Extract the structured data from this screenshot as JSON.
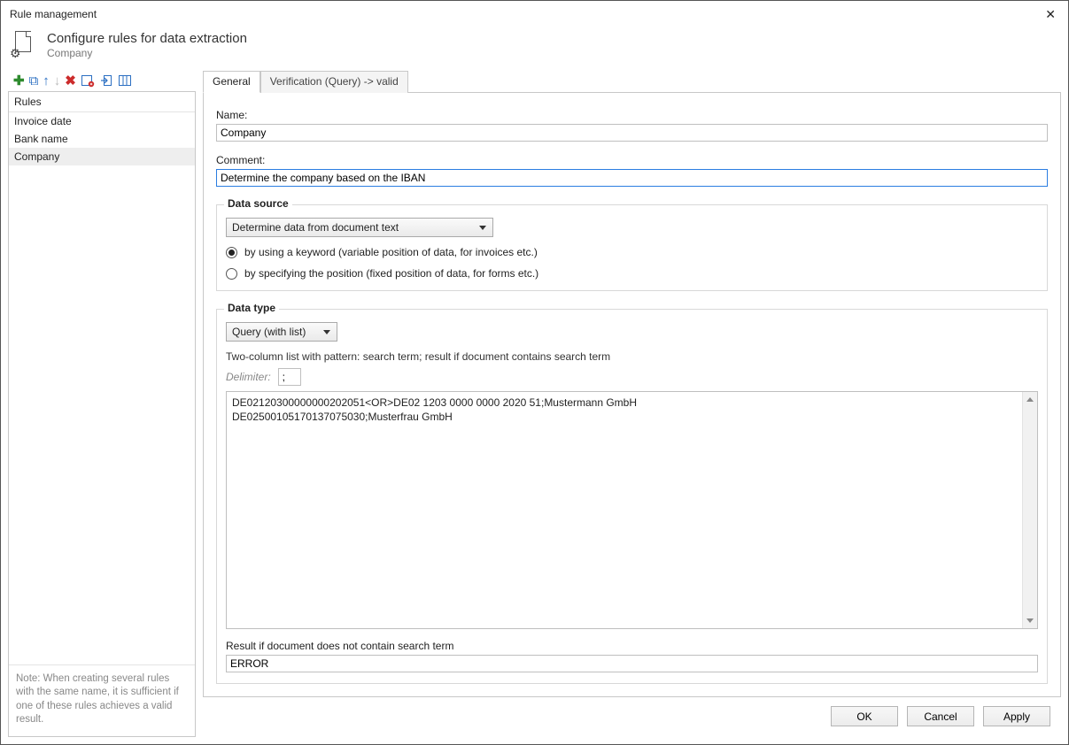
{
  "window": {
    "title": "Rule management"
  },
  "header": {
    "title": "Configure rules for data extraction",
    "subtitle": "Company"
  },
  "sidebar": {
    "header": "Rules",
    "items": [
      "Invoice date",
      "Bank name",
      "Company"
    ],
    "selected_index": 2,
    "note": "Note: When creating several rules with the same name, it is sufficient if one of these rules achieves a valid result."
  },
  "tabs": {
    "general": "General",
    "verification": "Verification (Query) -> valid",
    "active_index": 0
  },
  "general": {
    "name_label": "Name:",
    "name_value": "Company",
    "comment_label": "Comment:",
    "comment_value": "Determine the company based on the IBAN"
  },
  "datasource": {
    "legend": "Data source",
    "mode_value": "Determine data from document text",
    "radio_keyword": "by using a keyword (variable position of data, for invoices etc.)",
    "radio_position": "by specifying the position (fixed position of data, for forms etc.)",
    "selected_radio": 0
  },
  "datatype": {
    "legend": "Data type",
    "type_value": "Query (with list)",
    "pattern_hint": "Two-column list with pattern: search term; result if document contains search term",
    "delimiter_label": "Delimiter:",
    "delimiter_value": ";",
    "list_text": "DE02120300000000202051<OR>DE02 1203 0000 0000 2020 51;Mustermann GmbH\nDE02500105170137075030;Musterfrau GmbH",
    "result_label": "Result if document does not contain search term",
    "result_value": "ERROR"
  },
  "footer": {
    "ok": "OK",
    "cancel": "Cancel",
    "apply": "Apply"
  }
}
